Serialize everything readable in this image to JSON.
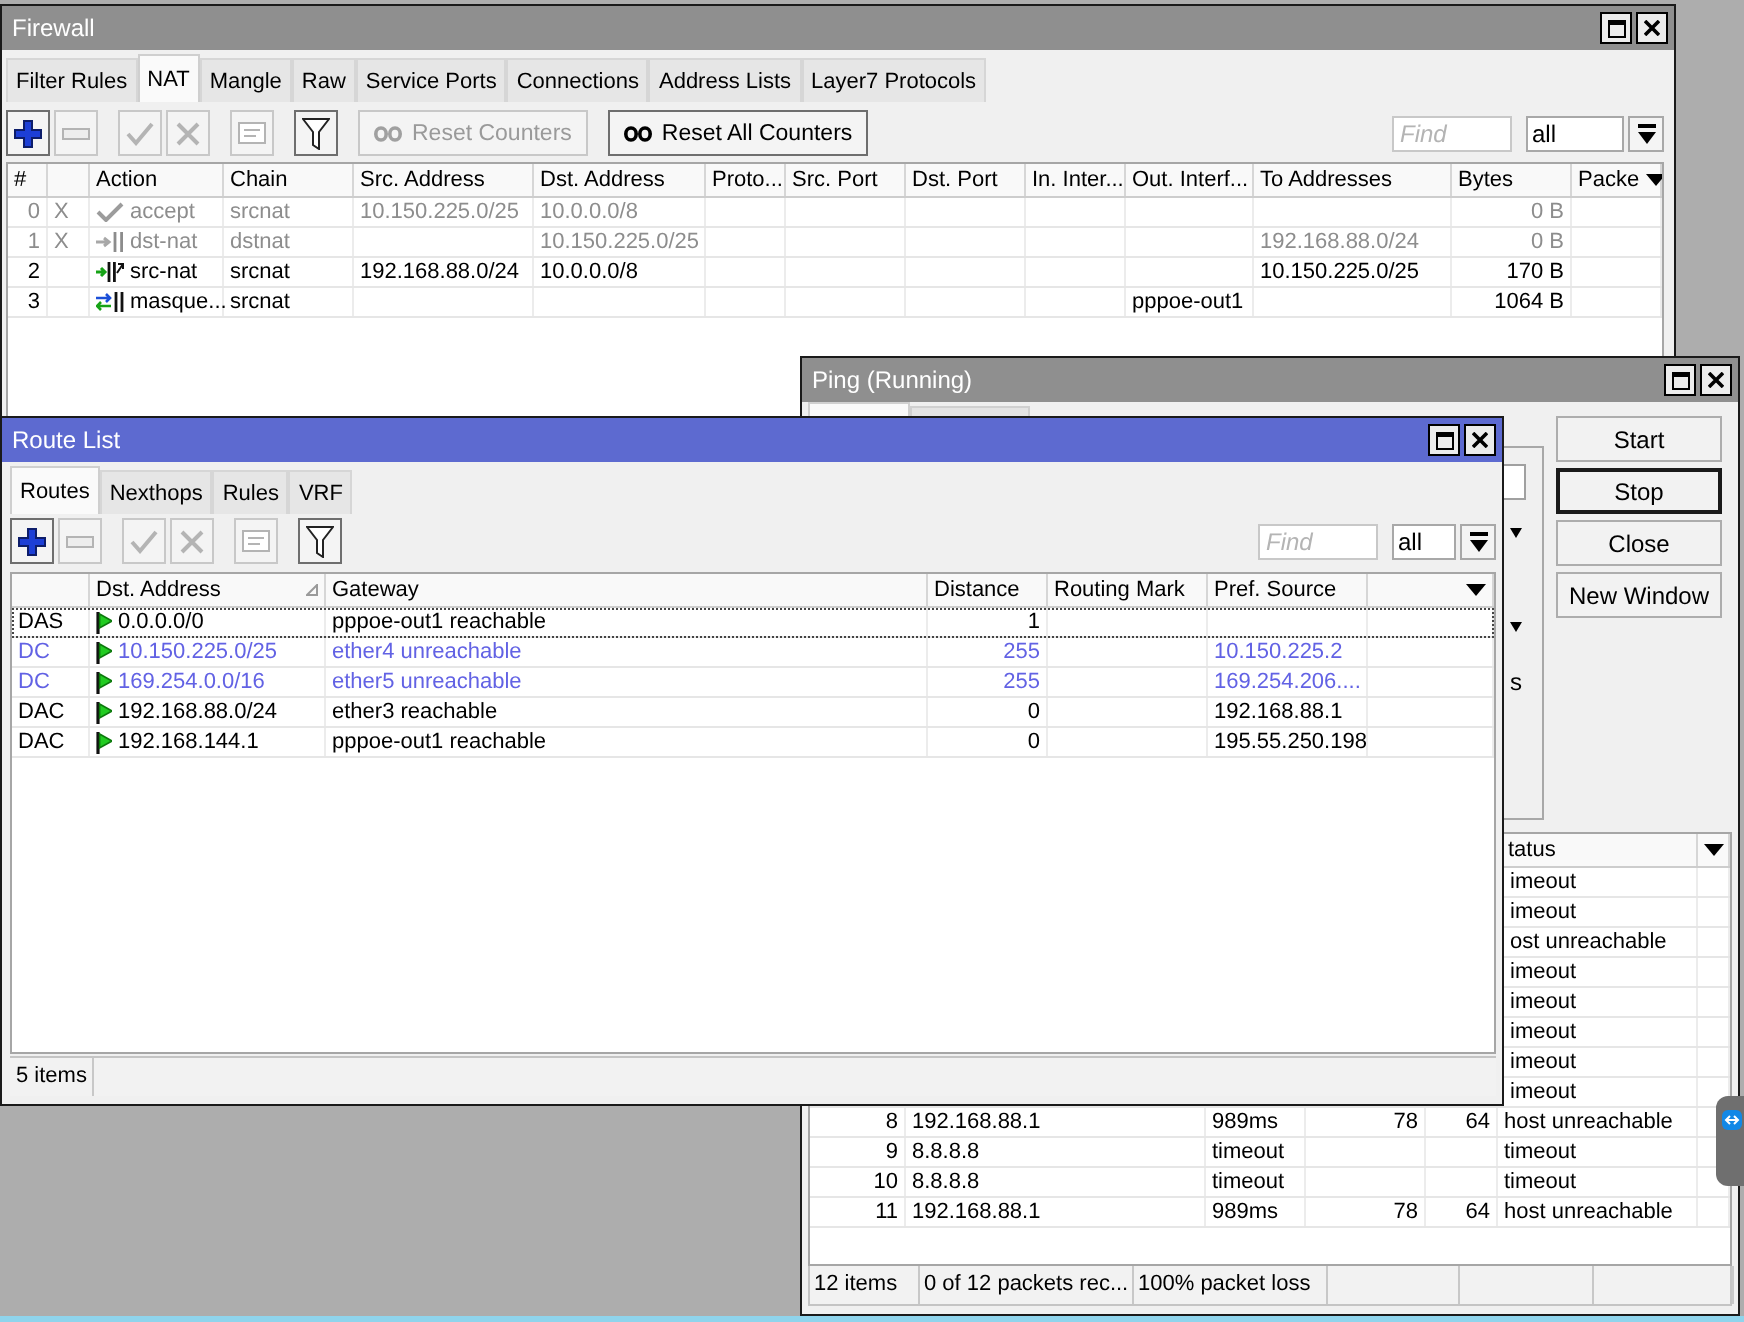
{
  "firewall": {
    "title": "Firewall",
    "active": false,
    "tabs": [
      {
        "label": "Filter Rules",
        "selected": false
      },
      {
        "label": "NAT",
        "selected": true
      },
      {
        "label": "Mangle",
        "selected": false
      },
      {
        "label": "Raw",
        "selected": false
      },
      {
        "label": "Service Ports",
        "selected": false
      },
      {
        "label": "Connections",
        "selected": false
      },
      {
        "label": "Address Lists",
        "selected": false
      },
      {
        "label": "Layer7 Protocols",
        "selected": false
      }
    ],
    "toolbar": {
      "tools": [
        {
          "kind": "add",
          "disabled": false
        },
        {
          "kind": "remove",
          "disabled": true
        },
        {
          "kind": "enable",
          "disabled": true
        },
        {
          "kind": "disable",
          "disabled": true
        },
        {
          "kind": "comment",
          "disabled": true
        },
        {
          "kind": "filter",
          "disabled": false
        }
      ],
      "actions": [
        {
          "label": "Reset Counters",
          "disabled": true
        },
        {
          "label": "Reset All Counters",
          "disabled": false
        }
      ],
      "find": {
        "placeholder": "Find"
      },
      "scope": {
        "value": "all"
      }
    },
    "table": {
      "columns": [
        "#",
        "Action",
        "Chain",
        "Src. Address",
        "Dst. Address",
        "Proto...",
        "Src. Port",
        "Dst. Port",
        "In. Inter...",
        "Out. Interf...",
        "To Addresses",
        "Bytes",
        "Packe"
      ],
      "rows": [
        {
          "number": "0",
          "flag": "X",
          "kind": "accept",
          "action": "accept",
          "chain": "srcnat",
          "src_address": "10.150.225.0/25",
          "dst_address": "10.0.0.0/8",
          "bytes": "0 B",
          "disabled": true
        },
        {
          "number": "1",
          "flag": "X",
          "kind": "dst-nat",
          "action": "dst-nat",
          "chain": "dstnat",
          "dst_address": "10.150.225.0/25",
          "to_addresses": "192.168.88.0/24",
          "bytes": "0 B",
          "disabled": true
        },
        {
          "number": "2",
          "kind": "src-nat",
          "action": "src-nat",
          "chain": "srcnat",
          "src_address": "192.168.88.0/24",
          "dst_address": "10.0.0.0/8",
          "to_addresses": "10.150.225.0/25",
          "bytes": "170 B",
          "disabled": false
        },
        {
          "number": "3",
          "kind": "masquerade",
          "action": "masque...",
          "chain": "srcnat",
          "out_interface": "pppoe-out1",
          "bytes": "1064 B",
          "disabled": false
        }
      ]
    }
  },
  "ping": {
    "title": "Ping (Running)",
    "active": false,
    "tabs": [
      {
        "selected": true
      },
      {
        "selected": false
      }
    ],
    "form": {
      "label_fragment": "s"
    },
    "buttons": [
      {
        "label": "Start",
        "default": false
      },
      {
        "label": "Stop",
        "default": true
      },
      {
        "label": "Close",
        "default": false
      },
      {
        "label": "New Window",
        "default": false
      }
    ],
    "table": {
      "status_header": "tatus",
      "rows": [
        {
          "kind": "covered",
          "status": "imeout"
        },
        {
          "kind": "covered",
          "status": "imeout"
        },
        {
          "kind": "covered",
          "status": "ost unreachable"
        },
        {
          "kind": "covered",
          "status": "imeout"
        },
        {
          "kind": "covered",
          "status": "imeout"
        },
        {
          "kind": "covered",
          "status": "imeout"
        },
        {
          "kind": "covered",
          "status": "imeout"
        },
        {
          "kind": "covered",
          "status": "imeout"
        },
        {
          "kind": "full",
          "seq": "8",
          "host": "192.168.88.1",
          "time": "989ms",
          "size": "78",
          "ttl": "64",
          "status": "host unreachable"
        },
        {
          "kind": "full",
          "seq": "9",
          "host": "8.8.8.8",
          "time": "timeout",
          "status": "timeout"
        },
        {
          "kind": "full",
          "seq": "10",
          "host": "8.8.8.8",
          "time": "timeout",
          "status": "timeout"
        },
        {
          "kind": "full",
          "seq": "11",
          "host": "192.168.88.1",
          "time": "989ms",
          "size": "78",
          "ttl": "64",
          "status": "host unreachable"
        }
      ]
    },
    "status_bar": [
      "12 items",
      "0 of 12 packets rec...",
      "100% packet loss"
    ]
  },
  "route_list": {
    "title": "Route List",
    "active": true,
    "tabs": [
      {
        "label": "Routes",
        "selected": true
      },
      {
        "label": "Nexthops",
        "selected": false
      },
      {
        "label": "Rules",
        "selected": false
      },
      {
        "label": "VRF",
        "selected": false
      }
    ],
    "toolbar": {
      "tools": [
        {
          "kind": "add",
          "disabled": false
        },
        {
          "kind": "remove",
          "disabled": true
        },
        {
          "kind": "enable",
          "disabled": true
        },
        {
          "kind": "disable",
          "disabled": true
        },
        {
          "kind": "comment",
          "disabled": true
        },
        {
          "kind": "filter",
          "disabled": false
        }
      ],
      "find": {
        "placeholder": "Find"
      },
      "scope": {
        "value": "all"
      }
    },
    "table": {
      "columns": [
        {
          "label": "Dst. Address",
          "sorted": true
        },
        {
          "label": "Gateway",
          "sorted": false
        },
        {
          "label": "Distance",
          "sorted": false
        },
        {
          "label": "Routing Mark",
          "sorted": false
        },
        {
          "label": "Pref. Source",
          "sorted": false
        }
      ],
      "rows": [
        {
          "flags": "DAS",
          "dst_address": "0.0.0.0/0",
          "gateway": "pppoe-out1 reachable",
          "distance": "1",
          "active": true,
          "focused": true
        },
        {
          "flags": "DC",
          "dst_address": "10.150.225.0/25",
          "gateway": "ether4 unreachable",
          "distance": "255",
          "pref_source": "10.150.225.2",
          "active": false,
          "focused": false
        },
        {
          "flags": "DC",
          "dst_address": "169.254.0.0/16",
          "gateway": "ether5 unreachable",
          "distance": "255",
          "pref_source": "169.254.206....",
          "active": false,
          "focused": false
        },
        {
          "flags": "DAC",
          "dst_address": "192.168.88.0/24",
          "gateway": "ether3 reachable",
          "distance": "0",
          "pref_source": "192.168.88.1",
          "active": true,
          "focused": false
        },
        {
          "flags": "DAC",
          "dst_address": "192.168.144.1",
          "gateway": "pppoe-out1 reachable",
          "distance": "0",
          "pref_source": "195.55.250.198",
          "active": true,
          "focused": false
        }
      ]
    },
    "status_bar": "5 items"
  }
}
